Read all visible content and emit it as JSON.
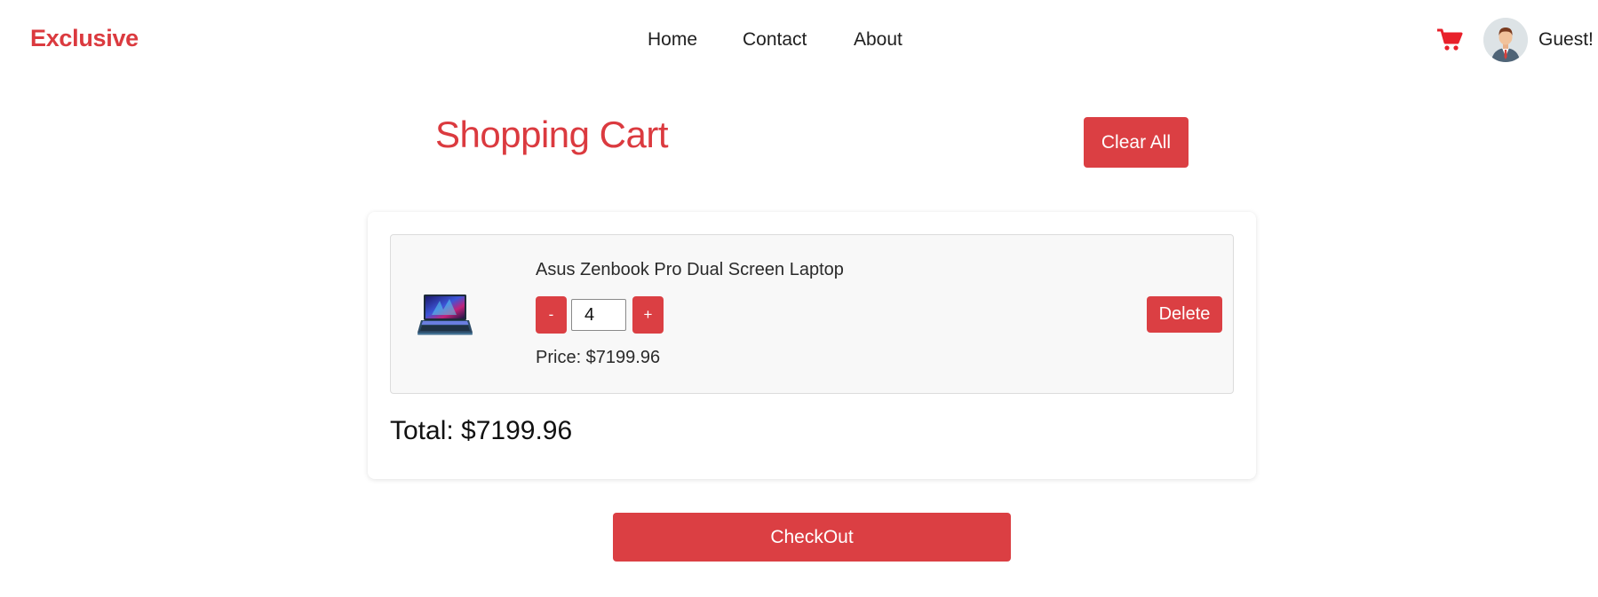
{
  "header": {
    "brand": "Exclusive",
    "nav": {
      "home": "Home",
      "contact": "Contact",
      "about": "About"
    },
    "cart_icon": "shopping-cart-icon",
    "user": {
      "avatar_icon": "user-avatar",
      "name": "Guest!"
    }
  },
  "cart": {
    "title": "Shopping Cart",
    "clear_all_label": "Clear All",
    "items": [
      {
        "image_icon": "laptop-image",
        "name": "Asus Zenbook Pro Dual Screen Laptop",
        "decrement_label": "-",
        "quantity": "4",
        "increment_label": "+",
        "price": "Price: $7199.96",
        "delete_label": "Delete"
      }
    ],
    "total": "Total: $7199.96",
    "checkout_label": "CheckOut"
  },
  "colors": {
    "accent": "#db3f43",
    "brand": "#db3a3f"
  }
}
